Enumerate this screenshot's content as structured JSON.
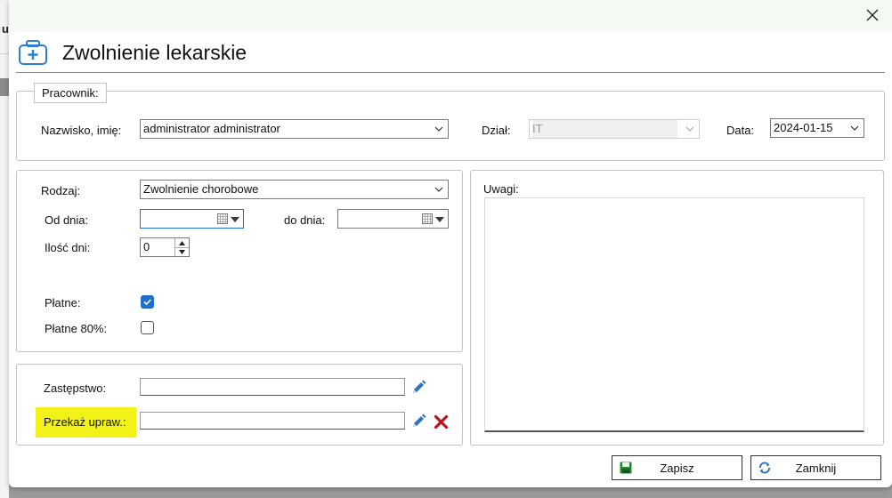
{
  "background": {
    "letter": "u"
  },
  "dialog": {
    "title": "Zwolnienie lekarskie",
    "header_icon": "medical-kit-icon",
    "close_icon": "close-icon"
  },
  "pracownik": {
    "legend": "Pracownik:",
    "name_label": "Nazwisko, imię:",
    "name_value": "administrator administrator",
    "dept_label": "Dział:",
    "dept_value": "IT",
    "date_label": "Data:",
    "date_value": "2024-01-15"
  },
  "details": {
    "type_label": "Rodzaj:",
    "type_value": "Zwolnienie chorobowe",
    "from_label": "Od dnia:",
    "from_value": "",
    "to_label": "do dnia:",
    "to_value": "",
    "days_label": "Ilość dni:",
    "days_value": "0",
    "paid_label": "Płatne:",
    "paid_checked": true,
    "paid80_label": "Płatne 80%:",
    "paid80_checked": false
  },
  "substitution": {
    "replacement_label": "Zastępstwo:",
    "replacement_value": "",
    "transfer_label": "Przekaż upraw.:",
    "transfer_value": "",
    "highlight_color": "#f2f218"
  },
  "notes": {
    "label": "Uwagi:",
    "value": ""
  },
  "buttons": {
    "save_label": "Zapisz",
    "close_label": "Zamknij"
  },
  "colors": {
    "accent": "#1f6fc9",
    "titlebar": "#f5fbf4",
    "delete": "#c0141b",
    "save_icon": "#1d8a2a"
  }
}
